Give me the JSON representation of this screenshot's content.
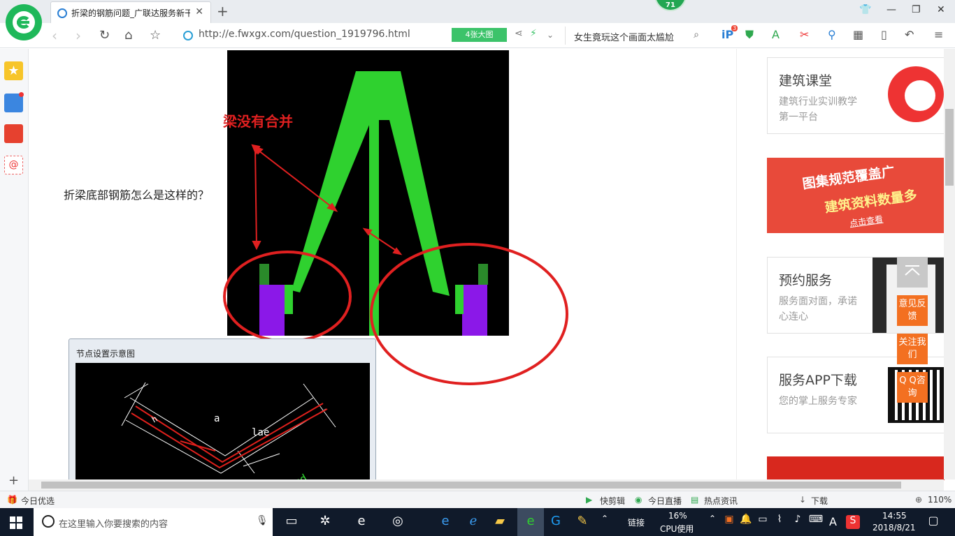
{
  "browser": {
    "tab_title": "折梁的钢筋问题_广联达服务新干",
    "notify_count": "71",
    "url": "http://e.fwxgx.com/question_1919796.html",
    "big_image_button": "4张大图",
    "search_text": "女生竟玩这个画面太尴尬",
    "ext_badge": "3"
  },
  "content": {
    "question_text": "折梁底部钢筋怎么是这样的？",
    "annotation": "梁没有合并",
    "dialog_title": "节点设置示意图",
    "diagram_labels": {
      "a": "a",
      "lae": "lae",
      "h": "h",
      "xd": "xd"
    }
  },
  "sidebar_right": {
    "card1": {
      "title": "建筑课堂",
      "subtitle": "建筑行业实训教学第一平台"
    },
    "banner": {
      "line1": "图集规范覆盖广",
      "line2": "建筑资料数量多",
      "link": "点击查看"
    },
    "card2": {
      "title": "预约服务",
      "subtitle": "服务面对面，承诺心连心"
    },
    "card3": {
      "title": "服务APP下载",
      "subtitle": "您的掌上服务专家"
    }
  },
  "float_buttons": {
    "feedback": "意见反馈",
    "follow": "关注我们",
    "qq": "Q Q咨询"
  },
  "statusbar": {
    "left": "今日优选",
    "items": [
      "快剪辑",
      "今日直播",
      "热点资讯",
      "下载",
      "110%"
    ]
  },
  "taskbar": {
    "search_placeholder": "在这里输入你要搜索的内容",
    "link_label": "链接",
    "cpu_percent": "16%",
    "cpu_label": "CPU使用",
    "ime": "A",
    "time": "14:55",
    "date": "2018/8/21"
  },
  "colors": {
    "green": "#2fd12f",
    "purple": "#8b18e8",
    "annotation_red": "#e02020",
    "accent_orange": "#f37021"
  }
}
